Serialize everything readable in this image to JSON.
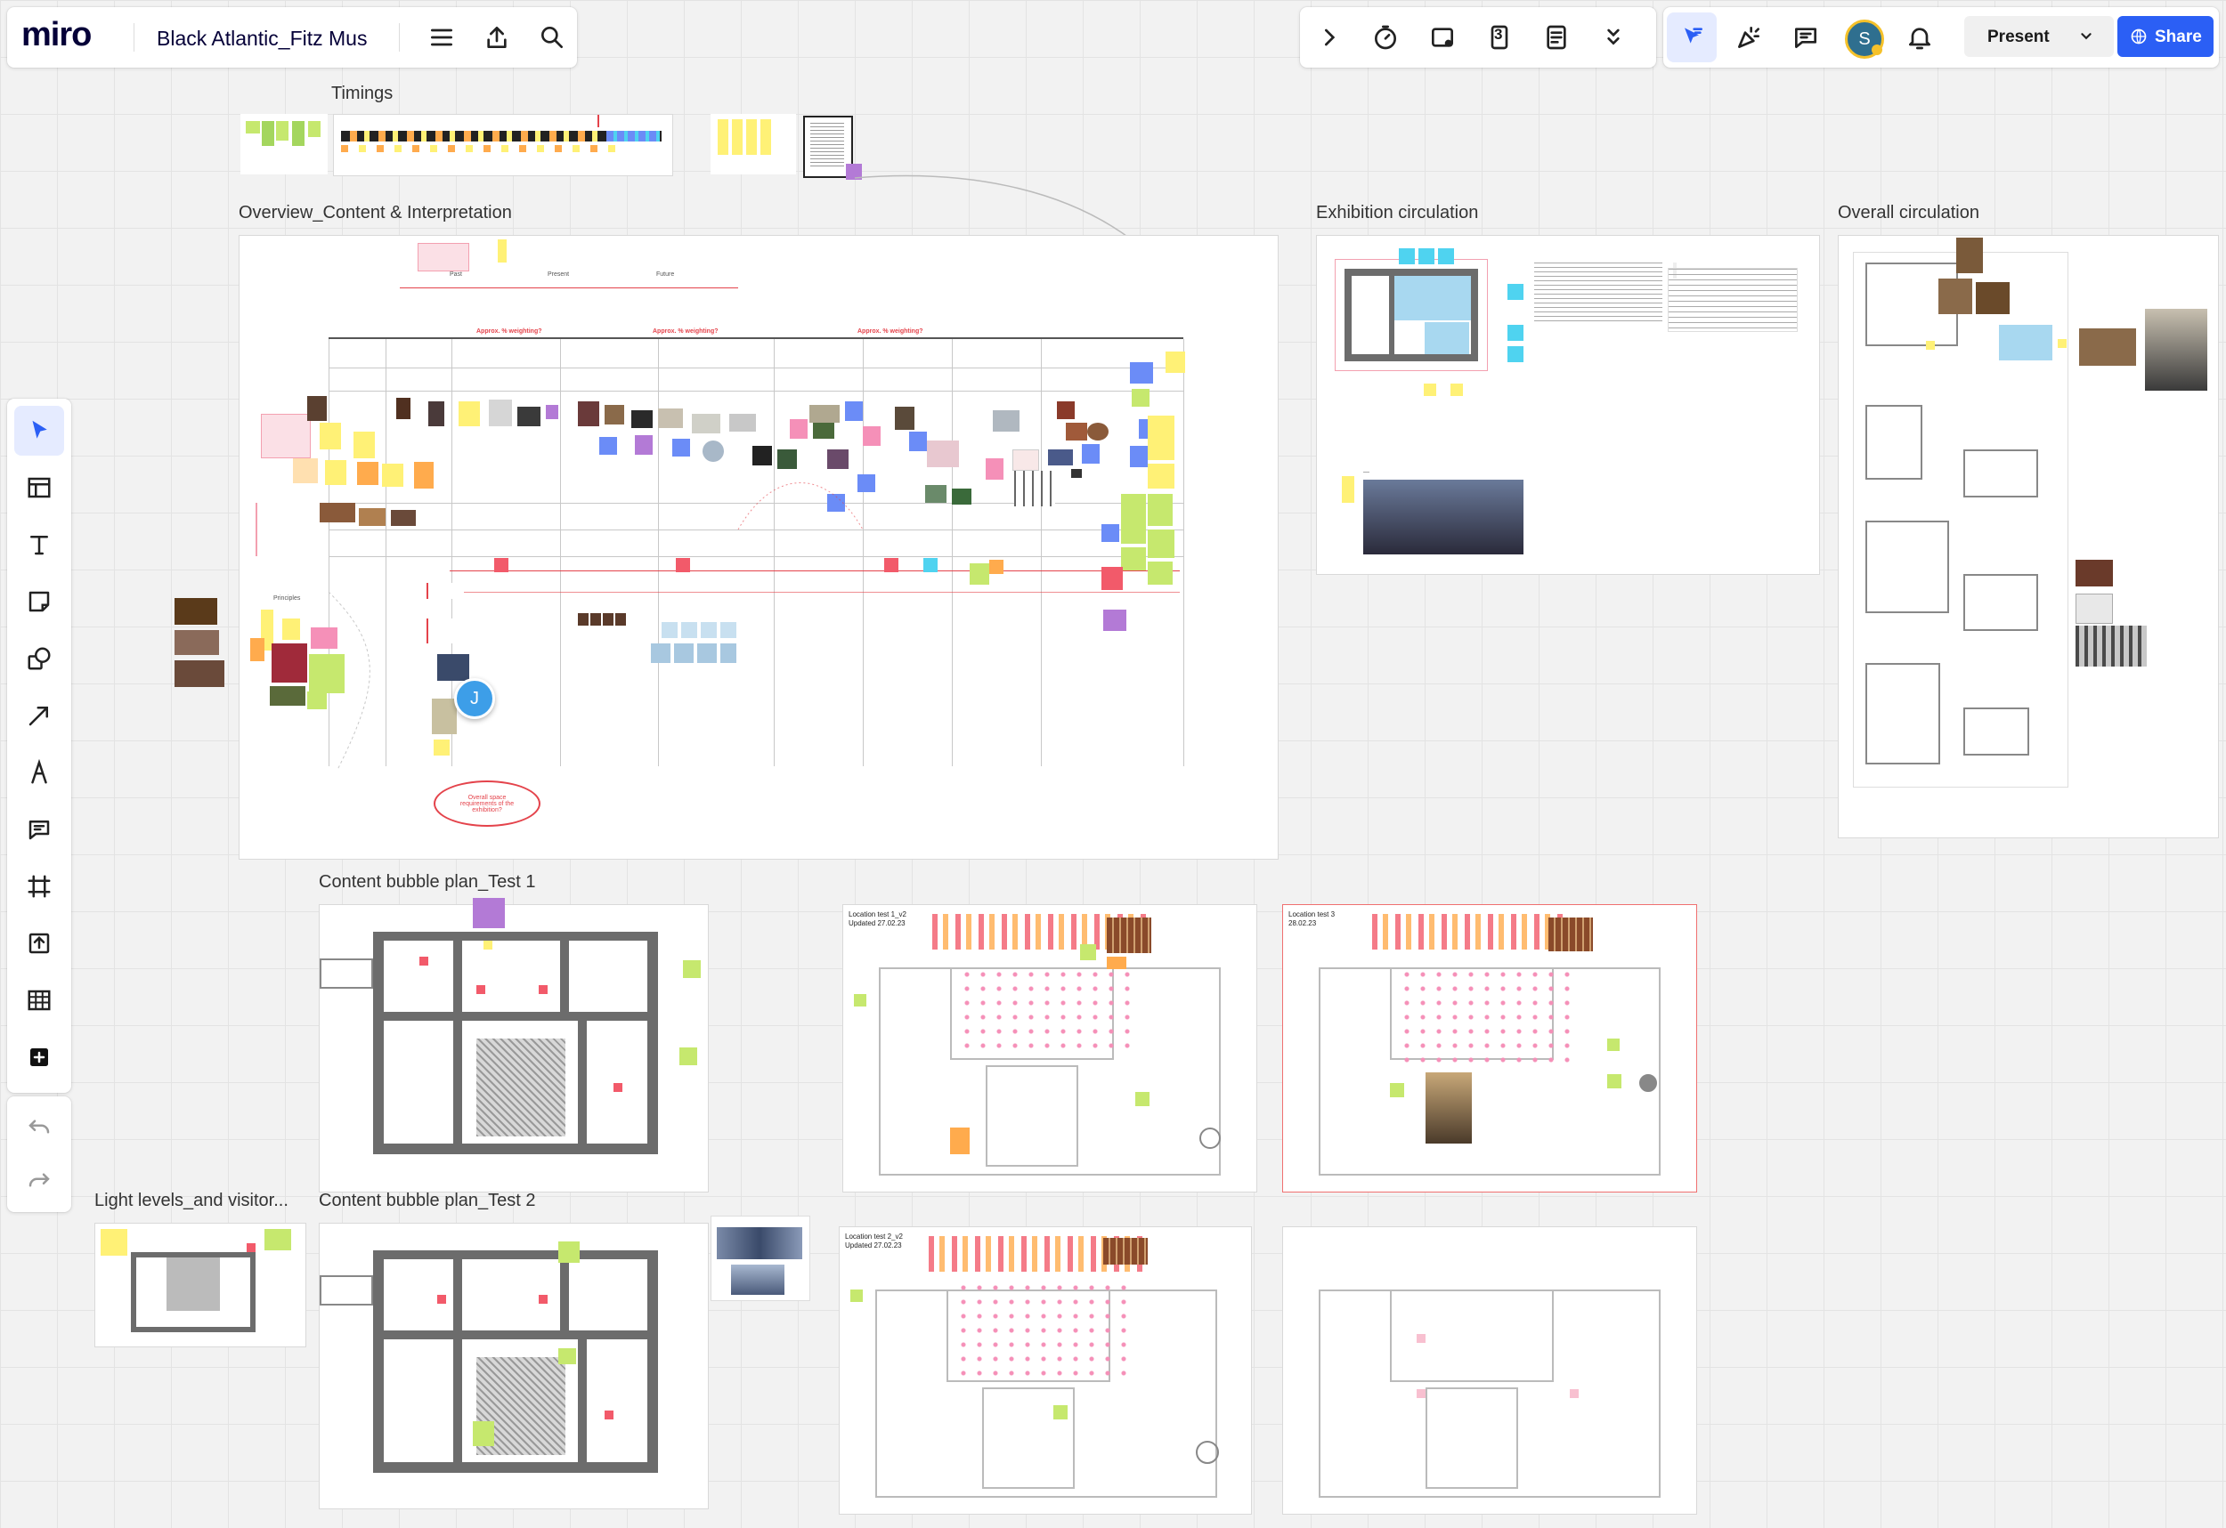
{
  "app": {
    "logo": "miro",
    "board_title": "Black Atlantic_Fitz Mus"
  },
  "top_left_toolbar": {
    "menu_icon": "hamburger-menu-icon",
    "export_icon": "upload-icon",
    "search_icon": "search-icon"
  },
  "top_center_toolbar": {
    "items": [
      "chevron-right-icon",
      "timer-icon",
      "voting-icon",
      "card-count-icon",
      "notes-icon",
      "chevrons-down-icon"
    ],
    "card_count": "3"
  },
  "top_right_toolbar": {
    "avatar_initial": "S",
    "present_label": "Present",
    "share_label": "Share",
    "accent_color": "#2b5ff5"
  },
  "left_tools": [
    "select-tool",
    "templates-tool",
    "text-tool",
    "sticky-note-tool",
    "shapes-tool",
    "connection-line-tool",
    "pen-tool",
    "comment-tool",
    "frame-tool",
    "upload-tool",
    "table-tool",
    "more-apps-tool",
    "undo",
    "redo"
  ],
  "frames": {
    "timings": "Timings",
    "overview": "Overview_Content & Interpretation",
    "exhibition_circulation": "Exhibition circulation",
    "overall_circulation": "Overall circulation",
    "bubble_plan_1": "Content bubble plan_Test 1",
    "bubble_plan_2": "Content bubble plan_Test 2",
    "light_levels": "Light levels_and visitor..."
  },
  "board_labels": {
    "location_test_1": "Location test 1_v2",
    "location_test_1_date": "Updated 27.02.23",
    "location_test_3": "Location test 3",
    "location_test_3_date": "28.02.23",
    "location_test_2": "Location test 2_v2",
    "location_test_2_date": "Updated 27.02.23",
    "overview_ellipse_text": "Overall space requirements of the exhibition?",
    "weighting_1": "Approx. % weighting?",
    "weighting_2": "Approx. % weighting?",
    "weighting_3": "Approx. % weighting?",
    "principles": "Principles"
  },
  "cursor_collaborator": {
    "initial": "J",
    "color": "#3d9ee8"
  },
  "colors": {
    "sticky_yellow": "#fff176",
    "sticky_green": "#c6e86e",
    "sticky_blue": "#6b8cf7",
    "sticky_orange": "#ffab4d",
    "sticky_pink": "#f590b8",
    "sticky_purple": "#b37ad6",
    "sticky_cyan": "#4fd3f0",
    "red_connector": "#e4434b"
  }
}
